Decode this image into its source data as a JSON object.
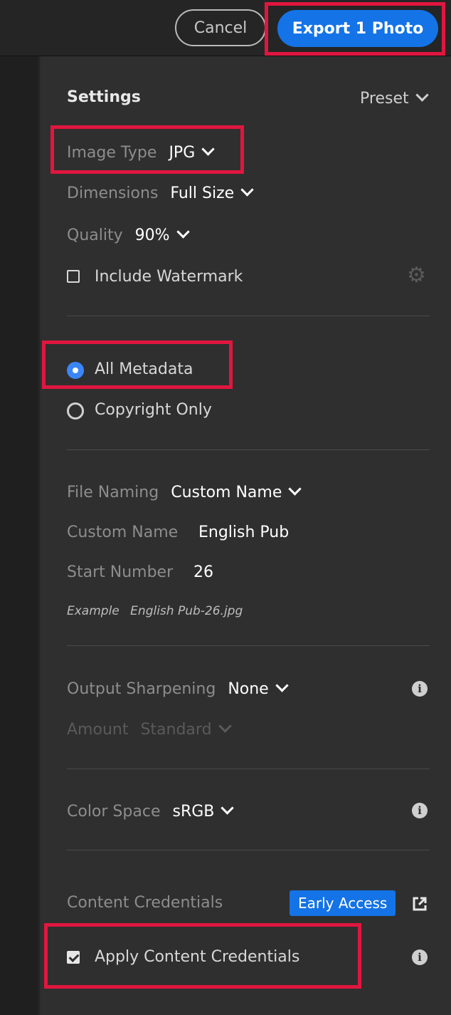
{
  "toolbar": {
    "cancel_label": "Cancel",
    "export_label": "Export 1 Photo"
  },
  "settings": {
    "title": "Settings",
    "preset_label": "Preset",
    "image_type": {
      "label": "Image Type",
      "value": "JPG"
    },
    "dimensions": {
      "label": "Dimensions",
      "value": "Full Size"
    },
    "quality": {
      "label": "Quality",
      "value": "90%"
    },
    "watermark": {
      "label": "Include Watermark",
      "checked": false
    }
  },
  "metadata": {
    "all_label": "All Metadata",
    "copyright_label": "Copyright Only",
    "selected": "All Metadata"
  },
  "file_naming": {
    "label": "File Naming",
    "value": "Custom Name",
    "custom_name_label": "Custom Name",
    "custom_name_value": "English Pub",
    "start_number_label": "Start Number",
    "start_number_value": "26",
    "example_label": "Example",
    "example_value": "English Pub-26.jpg"
  },
  "sharpening": {
    "label": "Output Sharpening",
    "value": "None",
    "amount_label": "Amount",
    "amount_value": "Standard"
  },
  "color_space": {
    "label": "Color Space",
    "value": "sRGB"
  },
  "content_credentials": {
    "label": "Content Credentials",
    "badge": "Early Access",
    "apply_label": "Apply Content Credentials",
    "apply_checked": true
  },
  "colors": {
    "accent": "#1473e6",
    "highlight": "#e0163f",
    "panel_bg": "#2f2f2f",
    "label_gray": "#8d8d8d"
  },
  "icons": [
    "chevron-down-icon",
    "gear-icon",
    "info-icon",
    "external-link-icon"
  ]
}
